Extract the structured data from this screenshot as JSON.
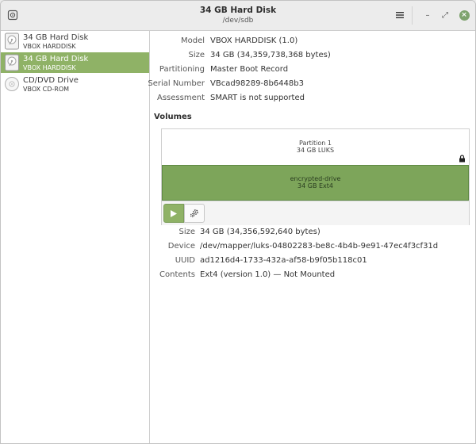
{
  "header": {
    "title": "34 GB Hard Disk",
    "subtitle": "/dev/sdb",
    "menu_icon": "hamburger-menu-icon",
    "window_controls": {
      "minimize": "–",
      "maximize": "⤢",
      "close": "×"
    }
  },
  "sidebar": {
    "items": [
      {
        "name": "34 GB Hard Disk",
        "sub": "VBOX HARDDISK",
        "icon": "hard-disk-icon",
        "selected": false
      },
      {
        "name": "34 GB Hard Disk",
        "sub": "VBOX HARDDISK",
        "icon": "hard-disk-icon",
        "selected": true
      },
      {
        "name": "CD/DVD Drive",
        "sub": "VBOX CD-ROM",
        "icon": "optical-drive-icon",
        "selected": false
      }
    ]
  },
  "disk": {
    "model_label": "Model",
    "model": "VBOX HARDDISK (1.0)",
    "size_label": "Size",
    "size": "34 GB (34,359,738,368 bytes)",
    "partitioning_label": "Partitioning",
    "partitioning": "Master Boot Record",
    "serial_label": "Serial Number",
    "serial": "VBcad98289-8b6448b3",
    "assessment_label": "Assessment",
    "assessment": "SMART is not supported"
  },
  "volumes": {
    "title": "Volumes",
    "partition": {
      "name": "Partition 1",
      "size": "34 GB LUKS"
    },
    "inner": {
      "name": "encrypted-drive",
      "size": "34 GB Ext4"
    }
  },
  "volume_details": {
    "size_label": "Size",
    "size": "34 GB (34,356,592,640 bytes)",
    "device_label": "Device",
    "device": "/dev/mapper/luks-04802283-be8c-4b4b-9e91-47ec4f3cf31d",
    "uuid_label": "UUID",
    "uuid": "ad1216d4-1733-432a-af58-b9f05b118c01",
    "contents_label": "Contents",
    "contents": "Ext4 (version 1.0) — Not Mounted"
  },
  "colors": {
    "accent": "#8fb266",
    "partition_fill": "#7da55a"
  }
}
